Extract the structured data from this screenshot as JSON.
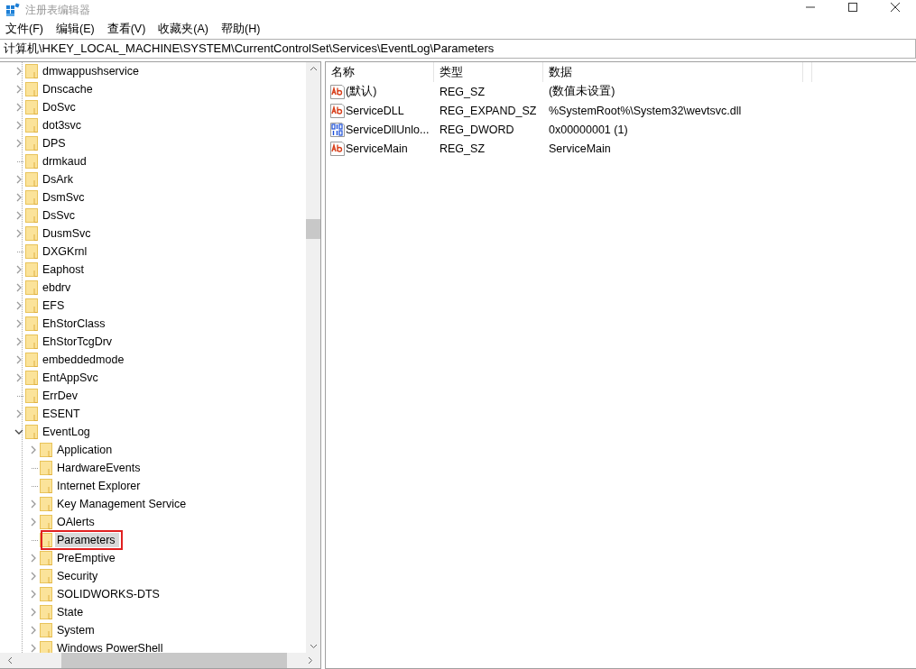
{
  "window": {
    "title": "注册表编辑器"
  },
  "menu": [
    "文件(F)",
    "编辑(E)",
    "查看(V)",
    "收藏夹(A)",
    "帮助(H)"
  ],
  "address": "计算机\\HKEY_LOCAL_MACHINE\\SYSTEM\\CurrentControlSet\\Services\\EventLog\\Parameters",
  "tree": {
    "items": [
      {
        "label": "dmwappushservice",
        "expandable": true,
        "expanded": false,
        "selected": false,
        "marked": false
      },
      {
        "label": "Dnscache",
        "expandable": true,
        "expanded": false,
        "selected": false,
        "marked": false
      },
      {
        "label": "DoSvc",
        "expandable": true,
        "expanded": false,
        "selected": false,
        "marked": false
      },
      {
        "label": "dot3svc",
        "expandable": true,
        "expanded": false,
        "selected": false,
        "marked": false
      },
      {
        "label": "DPS",
        "expandable": true,
        "expanded": false,
        "selected": false,
        "marked": false
      },
      {
        "label": "drmkaud",
        "expandable": false,
        "selected": false,
        "marked": false
      },
      {
        "label": "DsArk",
        "expandable": true,
        "expanded": false,
        "selected": false,
        "marked": false
      },
      {
        "label": "DsmSvc",
        "expandable": true,
        "expanded": false,
        "selected": false,
        "marked": false
      },
      {
        "label": "DsSvc",
        "expandable": true,
        "expanded": false,
        "selected": false,
        "marked": false
      },
      {
        "label": "DusmSvc",
        "expandable": true,
        "expanded": false,
        "selected": false,
        "marked": false
      },
      {
        "label": "DXGKrnl",
        "expandable": false,
        "selected": false,
        "marked": false
      },
      {
        "label": "Eaphost",
        "expandable": true,
        "expanded": false,
        "selected": false,
        "marked": false
      },
      {
        "label": "ebdrv",
        "expandable": true,
        "expanded": false,
        "selected": false,
        "marked": false
      },
      {
        "label": "EFS",
        "expandable": true,
        "expanded": false,
        "selected": false,
        "marked": false
      },
      {
        "label": "EhStorClass",
        "expandable": true,
        "expanded": false,
        "selected": false,
        "marked": false
      },
      {
        "label": "EhStorTcgDrv",
        "expandable": true,
        "expanded": false,
        "selected": false,
        "marked": false
      },
      {
        "label": "embeddedmode",
        "expandable": true,
        "expanded": false,
        "selected": false,
        "marked": false
      },
      {
        "label": "EntAppSvc",
        "expandable": true,
        "expanded": false,
        "selected": false,
        "marked": false
      },
      {
        "label": "ErrDev",
        "expandable": false,
        "selected": false,
        "marked": false
      },
      {
        "label": "ESENT",
        "expandable": true,
        "expanded": false,
        "selected": false,
        "marked": false
      },
      {
        "label": "EventLog",
        "expandable": true,
        "expanded": true,
        "selected": false,
        "marked": false,
        "children": [
          {
            "label": "Application",
            "expandable": true,
            "expanded": false,
            "selected": false,
            "marked": false
          },
          {
            "label": "HardwareEvents",
            "expandable": false,
            "selected": false,
            "marked": false
          },
          {
            "label": "Internet Explorer",
            "expandable": false,
            "selected": false,
            "marked": false
          },
          {
            "label": "Key Management Service",
            "expandable": true,
            "expanded": false,
            "selected": false,
            "marked": false
          },
          {
            "label": "OAlerts",
            "expandable": true,
            "expanded": false,
            "selected": false,
            "marked": false
          },
          {
            "label": "Parameters",
            "expandable": false,
            "selected": true,
            "marked": true
          },
          {
            "label": "PreEmptive",
            "expandable": true,
            "expanded": false,
            "selected": false,
            "marked": false
          },
          {
            "label": "Security",
            "expandable": true,
            "expanded": false,
            "selected": false,
            "marked": false
          },
          {
            "label": "SOLIDWORKS-DTS",
            "expandable": true,
            "expanded": false,
            "selected": false,
            "marked": false
          },
          {
            "label": "State",
            "expandable": true,
            "expanded": false,
            "selected": false,
            "marked": false
          },
          {
            "label": "System",
            "expandable": true,
            "expanded": false,
            "selected": false,
            "marked": false
          },
          {
            "label": "Windows PowerShell",
            "expandable": true,
            "expanded": false,
            "selected": false,
            "marked": false
          }
        ]
      }
    ]
  },
  "values": {
    "columns": [
      "名称",
      "类型",
      "数据"
    ],
    "rows": [
      {
        "kind": "string",
        "name": "(默认)",
        "type": "REG_SZ",
        "data": "(数值未设置)"
      },
      {
        "kind": "string",
        "name": "ServiceDLL",
        "type": "REG_EXPAND_SZ",
        "data": "%SystemRoot%\\System32\\wevtsvc.dll"
      },
      {
        "kind": "binary",
        "name": "ServiceDllUnlo...",
        "type": "REG_DWORD",
        "data": "0x00000001 (1)"
      },
      {
        "kind": "string",
        "name": "ServiceMain",
        "type": "REG_SZ",
        "data": "ServiceMain"
      }
    ]
  }
}
